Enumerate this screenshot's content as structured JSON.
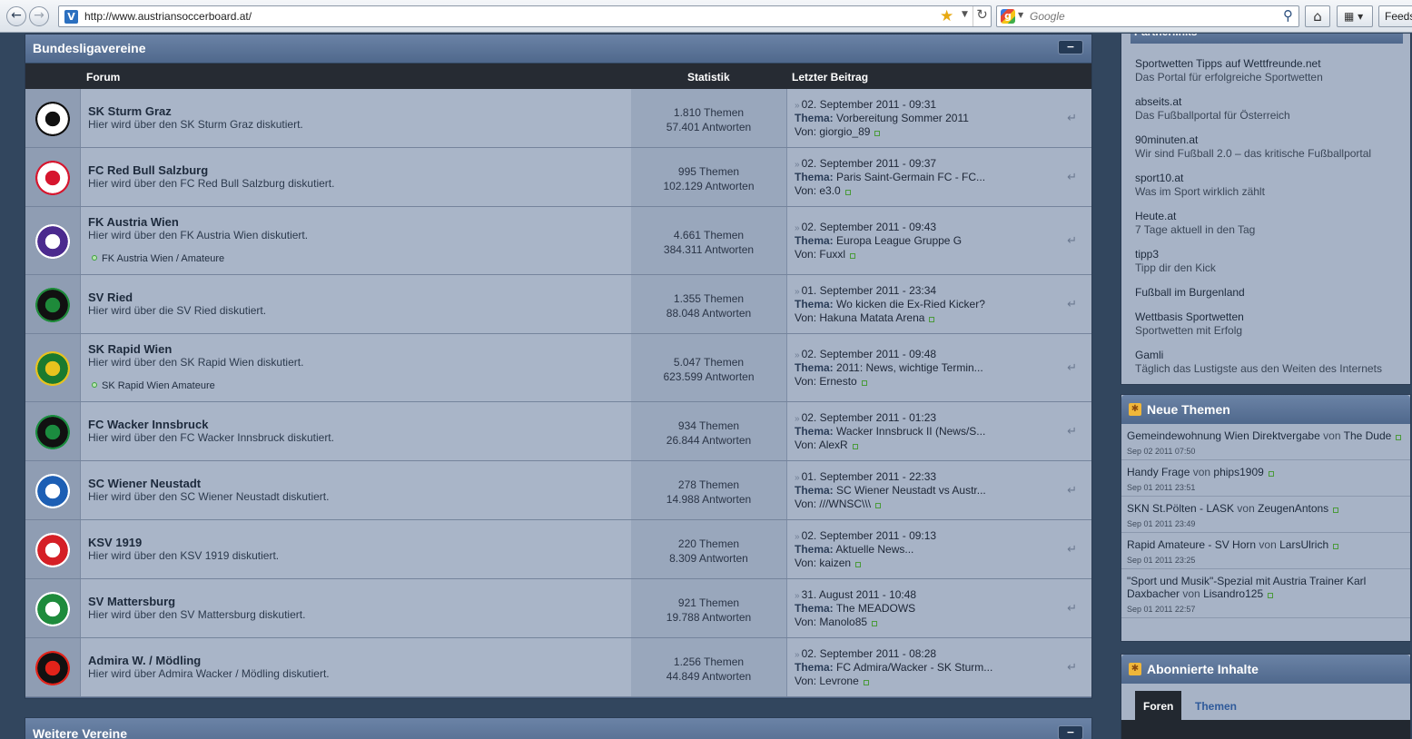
{
  "browser": {
    "url": "http://www.austriansoccerboard.at/",
    "search_placeholder": "Google",
    "feeds_label": "Feeds"
  },
  "category1": {
    "title": "Bundesligavereine",
    "collapse_label": "−"
  },
  "columns": {
    "forum": "Forum",
    "stats": "Statistik",
    "last": "Letzter Beitrag"
  },
  "forums": [
    {
      "name": "SK Sturm Graz",
      "desc": "Hier wird über den SK Sturm Graz diskutiert.",
      "sub": "",
      "topics": "1.810 Themen",
      "replies": "57.401 Antworten",
      "date": "02. September 2011 - 09:31",
      "thema_label": "Thema:",
      "thema": "Vorbereitung Sommer 2011",
      "von_label": "Von:",
      "by": "giorgio_89",
      "crest_colors": [
        "#ffffff",
        "#111111"
      ]
    },
    {
      "name": "FC Red Bull Salzburg",
      "desc": "Hier wird über den FC Red Bull Salzburg diskutiert.",
      "sub": "",
      "topics": "995 Themen",
      "replies": "102.129 Antworten",
      "date": "02. September 2011 - 09:37",
      "thema_label": "Thema:",
      "thema": "Paris Saint-Germain FC - FC...",
      "von_label": "Von:",
      "by": "e3.0",
      "crest_colors": [
        "#ffffff",
        "#d6162e"
      ]
    },
    {
      "name": "FK Austria Wien",
      "desc": "Hier wird über den FK Austria Wien diskutiert.",
      "sub": "FK Austria Wien / Amateure",
      "topics": "4.661 Themen",
      "replies": "384.311 Antworten",
      "date": "02. September 2011 - 09:43",
      "thema_label": "Thema:",
      "thema": "Europa League Gruppe G",
      "von_label": "Von:",
      "by": "Fuxxl",
      "crest_colors": [
        "#4b2a8e",
        "#ffffff"
      ]
    },
    {
      "name": "SV Ried",
      "desc": "Hier wird über die SV Ried diskutiert.",
      "sub": "",
      "topics": "1.355 Themen",
      "replies": "88.048 Antworten",
      "date": "01. September 2011 - 23:34",
      "thema_label": "Thema:",
      "thema": "Wo kicken die Ex-Ried Kicker?",
      "von_label": "Von:",
      "by": "Hakuna Matata Arena",
      "crest_colors": [
        "#111111",
        "#1e8a3a"
      ]
    },
    {
      "name": "SK Rapid Wien",
      "desc": "Hier wird über den SK Rapid Wien diskutiert.",
      "sub": "SK Rapid Wien Amateure",
      "topics": "5.047 Themen",
      "replies": "623.599 Antworten",
      "date": "02. September 2011 - 09:48",
      "thema_label": "Thema:",
      "thema": "2011: News, wichtige Termin...",
      "von_label": "Von:",
      "by": "Ernesto",
      "crest_colors": [
        "#1a7a2e",
        "#e8c21e"
      ]
    },
    {
      "name": "FC Wacker Innsbruck",
      "desc": "Hier wird über den FC Wacker Innsbruck diskutiert.",
      "sub": "",
      "topics": "934 Themen",
      "replies": "26.844 Antworten",
      "date": "02. September 2011 - 01:23",
      "thema_label": "Thema:",
      "thema": "Wacker Innsbruck II (News/S...",
      "von_label": "Von:",
      "by": "AlexR",
      "crest_colors": [
        "#111111",
        "#1b8c3f"
      ]
    },
    {
      "name": "SC Wiener Neustadt",
      "desc": "Hier wird über den SC Wiener Neustadt diskutiert.",
      "sub": "",
      "topics": "278 Themen",
      "replies": "14.988 Antworten",
      "date": "01. September 2011 - 22:33",
      "thema_label": "Thema:",
      "thema": "SC Wiener Neustadt vs Austr...",
      "von_label": "Von:",
      "by": "///WNSC\\\\\\",
      "crest_colors": [
        "#1d5fb4",
        "#ffffff"
      ]
    },
    {
      "name": "KSV 1919",
      "desc": "Hier wird über den KSV 1919 diskutiert.",
      "sub": "",
      "topics": "220 Themen",
      "replies": "8.309 Antworten",
      "date": "02. September 2011 - 09:13",
      "thema_label": "Thema:",
      "thema": "Aktuelle News...",
      "von_label": "Von:",
      "by": "kaizen",
      "crest_colors": [
        "#d51f26",
        "#ffffff"
      ]
    },
    {
      "name": "SV Mattersburg",
      "desc": "Hier wird über den SV Mattersburg diskutiert.",
      "sub": "",
      "topics": "921 Themen",
      "replies": "19.788 Antworten",
      "date": "31. August 2011 - 10:48",
      "thema_label": "Thema:",
      "thema": "The MEADOWS",
      "von_label": "Von:",
      "by": "Manolo85",
      "crest_colors": [
        "#1e8b3c",
        "#ffffff"
      ]
    },
    {
      "name": "Admira W. / Mödling",
      "desc": "Hier wird über Admira Wacker / Mödling diskutiert.",
      "sub": "",
      "topics": "1.256 Themen",
      "replies": "44.849 Antworten",
      "date": "02. September 2011 - 08:28",
      "thema_label": "Thema:",
      "thema": "FC Admira/Wacker - SK Sturm...",
      "von_label": "Von:",
      "by": "Levrone",
      "crest_colors": [
        "#111111",
        "#e2231a"
      ]
    }
  ],
  "category2": {
    "title": "Weitere Vereine",
    "collapse_label": "−"
  },
  "partnerlinks": {
    "title": "Partnerlinks",
    "items": [
      {
        "title": "Sportwetten Tipps auf Wettfreunde.net",
        "sub": "Das Portal für erfolgreiche Sportwetten"
      },
      {
        "title": "abseits.at",
        "sub": "Das Fußballportal für Österreich"
      },
      {
        "title": "90minuten.at",
        "sub": "Wir sind Fußball 2.0 – das kritische Fußballportal"
      },
      {
        "title": "sport10.at",
        "sub": "Was im Sport wirklich zählt"
      },
      {
        "title": "Heute.at",
        "sub": "7 Tage aktuell in den Tag"
      },
      {
        "title": "tipp3",
        "sub": "Tipp dir den Kick"
      },
      {
        "title": "Fußball im Burgenland",
        "sub": ""
      },
      {
        "title": "Wettbasis Sportwetten",
        "sub": "Sportwetten mit Erfolg"
      },
      {
        "title": "Gamli",
        "sub": "Täglich das Lustigste aus den Weiten des Internets"
      }
    ]
  },
  "neue_themen": {
    "title": "Neue Themen",
    "items": [
      {
        "title": "Gemeindewohnung Wien Direktvergabe",
        "von": "von",
        "by": "The Dude",
        "date": "Sep 02 2011 07:50"
      },
      {
        "title": "Handy Frage",
        "von": "von",
        "by": "phips1909",
        "date": "Sep 01 2011 23:51"
      },
      {
        "title": "SKN St.Pölten - LASK",
        "von": "von",
        "by": "ZeugenAntons",
        "date": "Sep 01 2011 23:49"
      },
      {
        "title": "Rapid Amateure - SV Horn",
        "von": "von",
        "by": "LarsUlrich",
        "date": "Sep 01 2011 23:25"
      },
      {
        "title": "\"Sport und Musik\"-Spezial mit Austria Trainer Karl Daxbacher",
        "von": "von",
        "by": "Lisandro125",
        "date": "Sep 01 2011 22:57"
      }
    ]
  },
  "abonnierte": {
    "title": "Abonnierte Inhalte",
    "tab_foren": "Foren",
    "tab_themen": "Themen"
  }
}
